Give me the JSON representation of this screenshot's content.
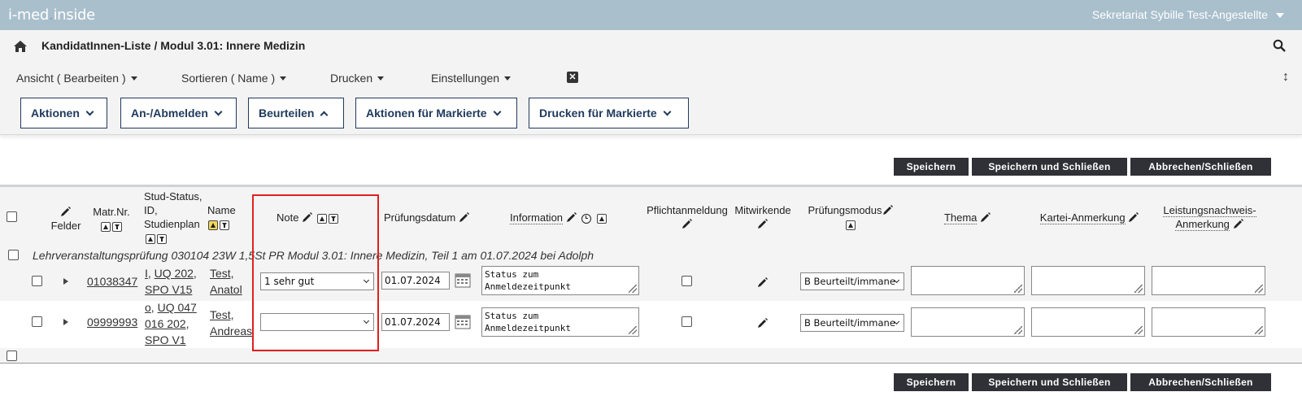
{
  "app": {
    "logo_main": "i-med",
    "logo_sep": ".",
    "logo_suffix": "inside",
    "user": "Sekretariat Sybille Test-Angestellte"
  },
  "header": {
    "title": "KandidatInnen-Liste / Modul 3.01: Innere Medizin"
  },
  "menu": {
    "ansicht": "Ansicht ( Bearbeiten )",
    "sortieren": "Sortieren ( Name )",
    "drucken": "Drucken",
    "einstellungen": "Einstellungen"
  },
  "action_buttons": {
    "aktionen": "Aktionen",
    "anmelden": "An-/Abmelden",
    "beurteilen": "Beurteilen",
    "aktionen_markierte": "Aktionen für Markierte",
    "drucken_markierte": "Drucken für Markierte"
  },
  "save_buttons": {
    "speichern": "Speichern",
    "speichern_schliessen": "Speichern und Schließen",
    "abbrechen": "Abbrechen/Schließen"
  },
  "columns": {
    "felder": "Felder",
    "matrnr": "Matr.Nr.",
    "stud_status_1": "Stud-Status,",
    "stud_status_2": "ID,",
    "stud_status_3": "Studienplan",
    "name": "Name",
    "note": "Note",
    "pruefungsdatum": "Prüfungsdatum",
    "information": "Information",
    "pflichtanmeldung": "Pflichtanmeldung",
    "mitwirkende": "Mitwirkende",
    "pruefungsmodus": "Prüfungsmodus",
    "thema": "Thema",
    "kartei": "Kartei-Anmerkung",
    "leistung_1": "Leistungsnachweis-",
    "leistung_2": "Anmerkung"
  },
  "group": {
    "label": "Lehrveranstaltungsprüfung 030104 23W 1,5St PR Modul 3.01: Innere Medizin, Teil 1 am 01.07.2024 bei Adolph"
  },
  "rows": [
    {
      "matrnr": "01038347",
      "status_letter": "I",
      "status_sep": ",",
      "id_1": "UQ 202",
      "id_1_sep": ",",
      "id_2": "",
      "plan": "SPO V15",
      "name_last": "Test,",
      "name_first": "Anatol",
      "note": "1 sehr gut",
      "date": "01.07.2024",
      "info_1": "Status zum",
      "info_2": "Anmeldezeitpunkt",
      "modus": "B Beurteilt/immane"
    },
    {
      "matrnr": "09999993",
      "status_letter": "o",
      "status_sep": ",",
      "id_1": "UQ 047",
      "id_1_sep": "",
      "id_2": "016 202",
      "plan": "SPO V1",
      "name_last": "Test,",
      "name_first": "Andreas",
      "note": "",
      "date": "01.07.2024",
      "info_1": "Status zum",
      "info_2": "Anmeldezeitpunkt",
      "modus": "B Beurteilt/immane"
    }
  ],
  "colors": {
    "topbar": "#a9bfcc",
    "navy": "#1f3a5c",
    "dark_button": "#2f3136",
    "highlight": "#e02020"
  }
}
